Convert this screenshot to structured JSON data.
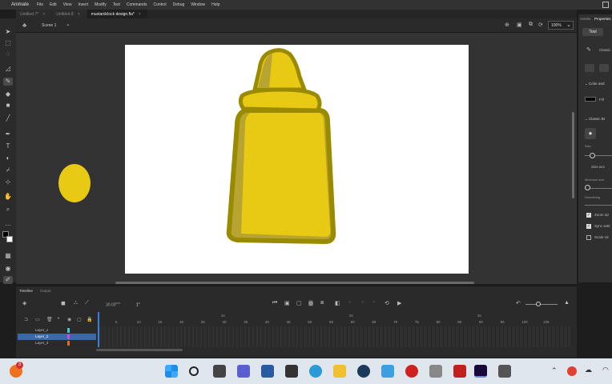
{
  "app": {
    "name": "Animate",
    "menus": [
      "File",
      "Edit",
      "View",
      "Insert",
      "Modify",
      "Text",
      "Commands",
      "Control",
      "Debug",
      "Window",
      "Help"
    ]
  },
  "document_tabs": [
    {
      "label": "Untitled-7*",
      "active": false
    },
    {
      "label": "Untitled-8",
      "active": false
    },
    {
      "label": "mustardclock design.fla*",
      "active": true
    }
  ],
  "scene": {
    "label": "Scene 1",
    "zoom": "100%"
  },
  "right_panel": {
    "tabs": [
      "Assets",
      "Properties"
    ],
    "tool_tab": "Tool",
    "tool_name": "Classic",
    "color_section": "Color and",
    "fill_label": "Fill",
    "brush_section": "Classic Br",
    "size_label": "Size",
    "size_option": "Size acc",
    "min_size_label": "Minimum size",
    "smoothing_label": "Smoothing",
    "checks": [
      {
        "label": "Zoom siz",
        "checked": true
      },
      {
        "label": "Sync setti",
        "checked": true
      },
      {
        "label": "Scale siz",
        "checked": false
      }
    ]
  },
  "timeline": {
    "tabs": [
      "Timeline",
      "Output"
    ],
    "fps": "30.00",
    "fps_unit": "FPS",
    "current_frame": "1",
    "frame_suffix": "F",
    "layers": [
      {
        "name": "Layer_1",
        "color": "#2fd4c4",
        "selected": false
      },
      {
        "name": "Layer_2",
        "color": "#e040e0",
        "selected": true
      },
      {
        "name": "Layer_3",
        "color": "#e07020",
        "selected": false
      }
    ],
    "frame_numbers": [
      "5",
      "10",
      "15",
      "20",
      "25",
      "30",
      "35",
      "40",
      "45",
      "50",
      "55",
      "60",
      "65",
      "70",
      "75",
      "80",
      "85",
      "90",
      "95",
      "100",
      "105"
    ],
    "markers": [
      "1s",
      "2s",
      "3s"
    ]
  },
  "taskbar": {
    "notification_count": "3"
  },
  "colors": {
    "mustard_fill": "#e8c914",
    "mustard_outline": "#9a8a00",
    "mustard_shade": "#b8a430",
    "selected_layer": "#3a68a8",
    "playhead": "#3a7fd8"
  }
}
